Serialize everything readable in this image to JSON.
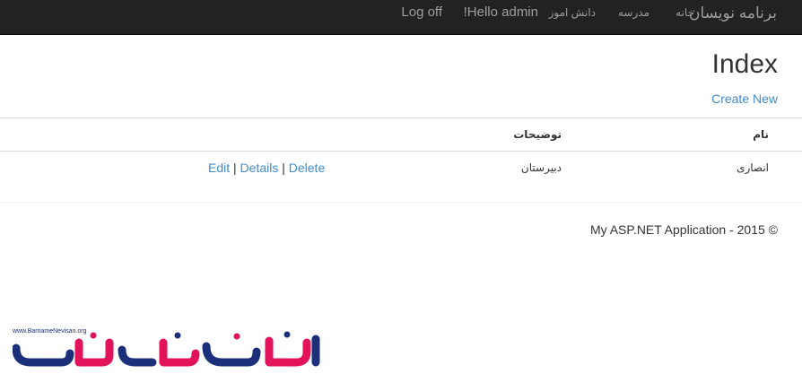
{
  "navbar": {
    "brand": "برنامه نویسان",
    "links": [
      "خانه",
      "مدرسه",
      "دانش اموز"
    ],
    "greeting": "Hello admin!",
    "logoff": "Log off"
  },
  "page": {
    "title": "Index",
    "create_new": "Create New"
  },
  "table": {
    "headers": {
      "name": "نام",
      "description": "توضیحات"
    },
    "rows": [
      {
        "name": "انصاری",
        "description": "دبیرستان"
      }
    ],
    "actions": {
      "edit": "Edit",
      "details": "Details",
      "delete": "Delete",
      "separator": "|"
    }
  },
  "footer": {
    "text": "© 2015 - My ASP.NET Application"
  },
  "watermark": {
    "url": "www.BarnameNevisan.org",
    "logo_text": "برنامه نویسان"
  },
  "colors": {
    "navbar_bg": "#222222",
    "nav_text": "#9d9d9d",
    "link": "#428bca",
    "logo_blue": "#1b2f7a",
    "logo_pink": "#e2125b"
  }
}
